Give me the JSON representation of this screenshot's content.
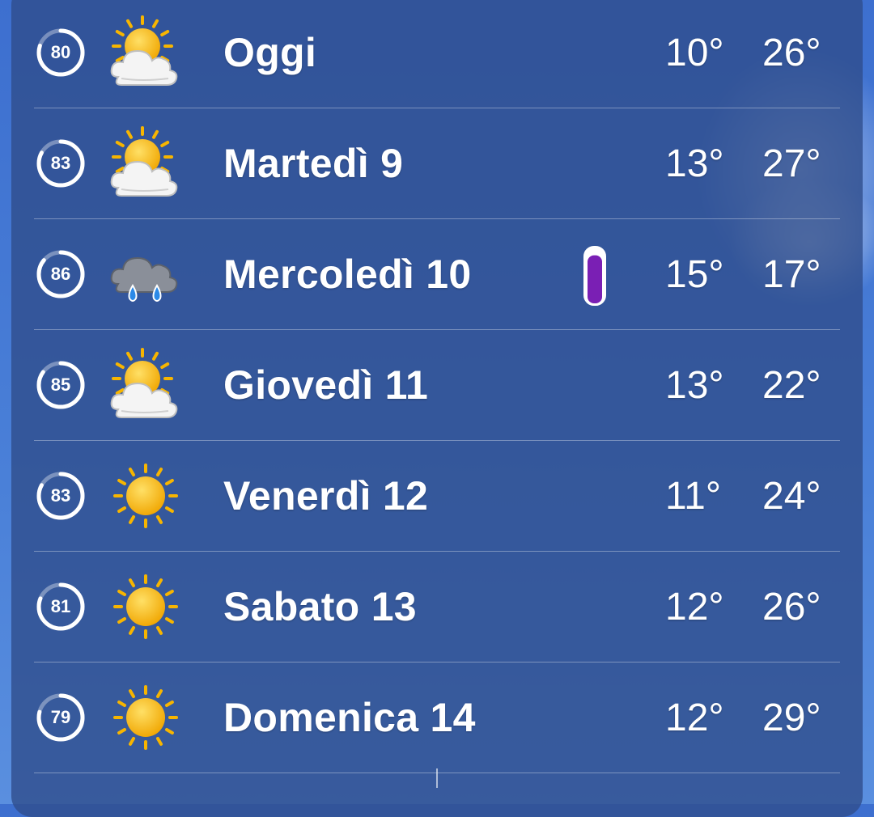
{
  "forecast": [
    {
      "score": "80",
      "day": "Oggi",
      "icon": "partly-cloudy-icon",
      "min": "10°",
      "max": "26°",
      "score_fill": 0.8
    },
    {
      "score": "83",
      "day": "Martedì 9",
      "icon": "partly-cloudy-icon",
      "min": "13°",
      "max": "27°",
      "score_fill": 0.83
    },
    {
      "score": "86",
      "day": "Mercoledì 10",
      "icon": "rain-cloud-icon",
      "min": "15°",
      "max": "17°",
      "score_fill": 0.86,
      "rain_fill": 0.9
    },
    {
      "score": "85",
      "day": "Giovedì 11",
      "icon": "partly-cloudy-icon",
      "min": "13°",
      "max": "22°",
      "score_fill": 0.85
    },
    {
      "score": "83",
      "day": "Venerdì 12",
      "icon": "sun-icon",
      "min": "11°",
      "max": "24°",
      "score_fill": 0.83
    },
    {
      "score": "81",
      "day": "Sabato 13",
      "icon": "sun-icon",
      "min": "12°",
      "max": "26°",
      "score_fill": 0.81
    },
    {
      "score": "79",
      "day": "Domenica 14",
      "icon": "sun-icon",
      "min": "12°",
      "max": "29°",
      "score_fill": 0.79
    }
  ],
  "colors": {
    "rain_bar": "#7a1fb4",
    "sun": "#f7b500",
    "ring": "#ffffff"
  }
}
